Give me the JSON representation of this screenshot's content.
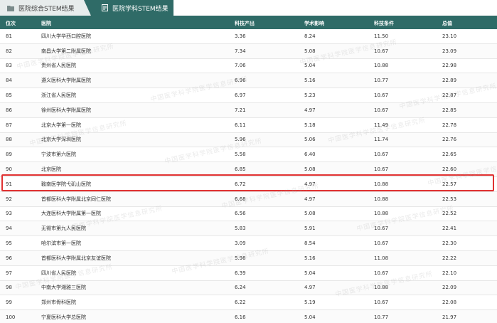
{
  "tabs": [
    {
      "label": "医院综合STEM结果",
      "active": false
    },
    {
      "label": "医院学科STEM结果",
      "active": true
    }
  ],
  "columns": [
    "位次",
    "医院",
    "科技产出",
    "学术影响",
    "科技条件",
    "总值"
  ],
  "rows": [
    {
      "rank": "81",
      "hospital": "四川大学华西口腔医院",
      "output": "3.36",
      "impact": "8.24",
      "condition": "11.50",
      "total": "23.10"
    },
    {
      "rank": "82",
      "hospital": "南昌大学第二附属医院",
      "output": "7.34",
      "impact": "5.08",
      "condition": "10.67",
      "total": "23.09"
    },
    {
      "rank": "83",
      "hospital": "贵州省人民医院",
      "output": "7.06",
      "impact": "5.04",
      "condition": "10.88",
      "total": "22.98"
    },
    {
      "rank": "84",
      "hospital": "遵义医科大学附属医院",
      "output": "6.96",
      "impact": "5.16",
      "condition": "10.77",
      "total": "22.89"
    },
    {
      "rank": "85",
      "hospital": "浙江省人民医院",
      "output": "6.97",
      "impact": "5.23",
      "condition": "10.67",
      "total": "22.87"
    },
    {
      "rank": "86",
      "hospital": "徐州医科大学附属医院",
      "output": "7.21",
      "impact": "4.97",
      "condition": "10.67",
      "total": "22.85"
    },
    {
      "rank": "87",
      "hospital": "北京大学第一医院",
      "output": "6.11",
      "impact": "5.18",
      "condition": "11.49",
      "total": "22.78"
    },
    {
      "rank": "88",
      "hospital": "北京大学深圳医院",
      "output": "5.96",
      "impact": "5.06",
      "condition": "11.74",
      "total": "22.76"
    },
    {
      "rank": "89",
      "hospital": "宁波市第六医院",
      "output": "5.58",
      "impact": "6.40",
      "condition": "10.67",
      "total": "22.65"
    },
    {
      "rank": "90",
      "hospital": "北京医院",
      "output": "6.85",
      "impact": "5.08",
      "condition": "10.67",
      "total": "22.60"
    },
    {
      "rank": "91",
      "hospital": "鞍南医学院弋矶山医院",
      "output": "6.72",
      "impact": "4.97",
      "condition": "10.88",
      "total": "22.57"
    },
    {
      "rank": "92",
      "hospital": "首都医科大学附属北京同仁医院",
      "output": "6.68",
      "impact": "4.97",
      "condition": "10.88",
      "total": "22.53"
    },
    {
      "rank": "93",
      "hospital": "大连医科大学附属第一医院",
      "output": "6.56",
      "impact": "5.08",
      "condition": "10.88",
      "total": "22.52"
    },
    {
      "rank": "94",
      "hospital": "无锡市第九人民医院",
      "output": "5.83",
      "impact": "5.91",
      "condition": "10.67",
      "total": "22.41"
    },
    {
      "rank": "95",
      "hospital": "哈尔滨市第一医院",
      "output": "3.09",
      "impact": "8.54",
      "condition": "10.67",
      "total": "22.30"
    },
    {
      "rank": "96",
      "hospital": "首都医科大学附属北京友谊医院",
      "output": "5.98",
      "impact": "5.16",
      "condition": "11.08",
      "total": "22.22"
    },
    {
      "rank": "97",
      "hospital": "四川省人民医院",
      "output": "6.39",
      "impact": "5.04",
      "condition": "10.67",
      "total": "22.10"
    },
    {
      "rank": "98",
      "hospital": "中南大学湘雅三医院",
      "output": "6.24",
      "impact": "4.97",
      "condition": "10.88",
      "total": "22.09"
    },
    {
      "rank": "99",
      "hospital": "郑州市骨科医院",
      "output": "6.22",
      "impact": "5.19",
      "condition": "10.67",
      "total": "22.08"
    },
    {
      "rank": "100",
      "hospital": "宁夏医科大学总医院",
      "output": "6.16",
      "impact": "5.04",
      "condition": "10.77",
      "total": "21.97"
    }
  ],
  "watermark": "中国医学科学院医学信息研究所",
  "colors": {
    "header": "#2f6b67",
    "highlight": "#e03131"
  }
}
